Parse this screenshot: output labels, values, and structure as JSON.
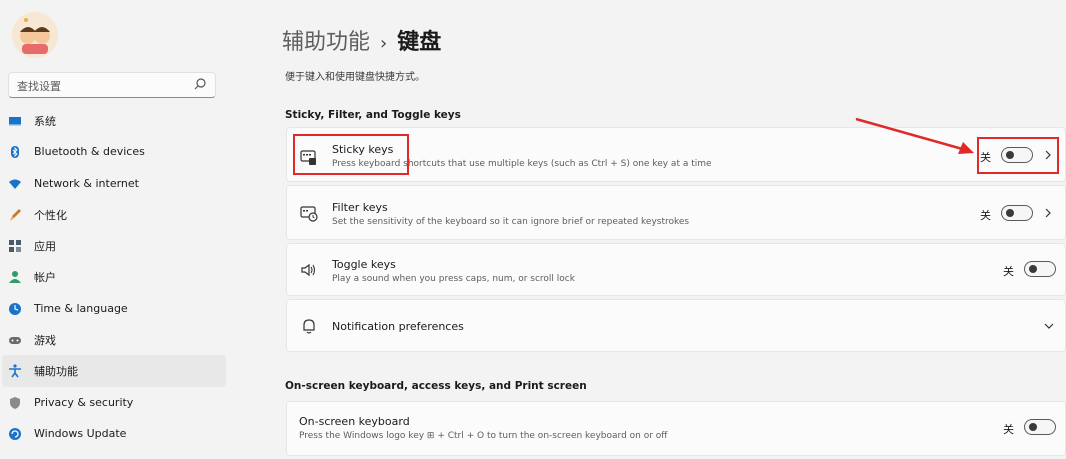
{
  "sidebar": {
    "search_placeholder": "查找设置",
    "items": [
      {
        "label": "系统",
        "icon": "monitor-icon",
        "color": "#1a73c9"
      },
      {
        "label": "Bluetooth & devices",
        "icon": "bluetooth-icon",
        "color": "#1a73c9"
      },
      {
        "label": "Network & internet",
        "icon": "wifi-icon",
        "color": "#1a73c9"
      },
      {
        "label": "个性化",
        "icon": "brush-icon",
        "color": "#c77b2a"
      },
      {
        "label": "应用",
        "icon": "apps-icon",
        "color": "#4a5a6a"
      },
      {
        "label": "帐户",
        "icon": "person-icon",
        "color": "#2e9d6a"
      },
      {
        "label": "Time & language",
        "icon": "globe-clock-icon",
        "color": "#1a73c9"
      },
      {
        "label": "游戏",
        "icon": "gamepad-icon",
        "color": "#6a6a6a"
      },
      {
        "label": "辅助功能",
        "icon": "accessibility-icon",
        "color": "#1a73c9",
        "active": true
      },
      {
        "label": "Privacy & security",
        "icon": "shield-icon",
        "color": "#6a6a6a"
      },
      {
        "label": "Windows Update",
        "icon": "update-icon",
        "color": "#1a73c9"
      }
    ]
  },
  "header": {
    "parent": "辅助功能",
    "separator": "›",
    "current": "键盘",
    "subtitle": "便于键入和使用键盘快捷方式。"
  },
  "sections": {
    "sticky_filter_toggle": "Sticky, Filter, and Toggle keys",
    "onscreen": "On-screen keyboard, access keys, and Print screen"
  },
  "cards": {
    "sticky": {
      "title": "Sticky keys",
      "desc": "Press keyboard shortcuts that use multiple keys (such as Ctrl + S) one key at a time",
      "state": "关"
    },
    "filter": {
      "title": "Filter keys",
      "desc": "Set the sensitivity of the keyboard so it can ignore brief or repeated keystrokes",
      "state": "关"
    },
    "toggle": {
      "title": "Toggle keys",
      "desc": "Play a sound when you press caps, num, or scroll lock",
      "state": "关"
    },
    "notification": {
      "title": "Notification preferences"
    },
    "onscreen": {
      "title": "On-screen keyboard",
      "desc": "Press the Windows logo key ⊞ + Ctrl + O to turn the on-screen keyboard on or off",
      "state": "关"
    }
  },
  "annotation": {
    "color": "#e02a2a"
  }
}
